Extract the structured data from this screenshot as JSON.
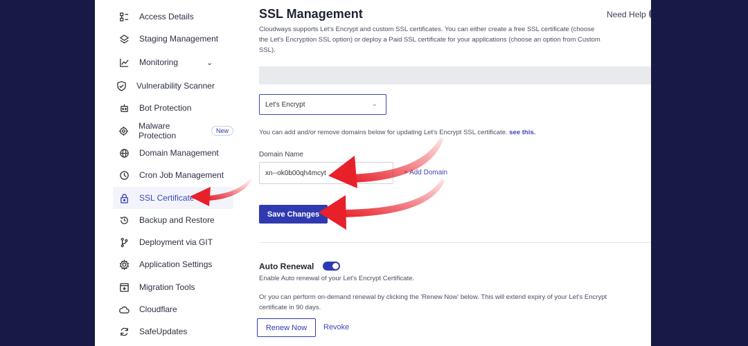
{
  "sidebar": {
    "items": [
      {
        "label": "Access Details",
        "icon": "access-details-icon"
      },
      {
        "label": "Staging Management",
        "icon": "layers-icon"
      },
      {
        "label": "Monitoring",
        "icon": "chart-icon"
      },
      {
        "label": "Vulnerability Scanner",
        "icon": "shield-scan-icon"
      },
      {
        "label": "Bot Protection",
        "icon": "bot-icon"
      },
      {
        "label": "Malware Protection",
        "icon": "malware-icon",
        "badge": "New"
      },
      {
        "label": "Domain Management",
        "icon": "www-icon"
      },
      {
        "label": "Cron Job Management",
        "icon": "clock-icon"
      },
      {
        "label": "SSL Certificate",
        "icon": "lock-icon"
      },
      {
        "label": "Backup and Restore",
        "icon": "restore-icon"
      },
      {
        "label": "Deployment via GIT",
        "icon": "git-branch-icon"
      },
      {
        "label": "Application Settings",
        "icon": "gear-icon"
      },
      {
        "label": "Migration Tools",
        "icon": "migration-icon"
      },
      {
        "label": "Cloudflare",
        "icon": "cloud-icon"
      },
      {
        "label": "SafeUpdates",
        "icon": "refresh-icon"
      }
    ],
    "monitoring_chevron": "⌄"
  },
  "main": {
    "title": "SSL Management",
    "help": "Need Help",
    "description": "Cloudways supports Let's Encrypt and custom SSL certificates. You can either create a free SSL certificate (choose the Let's Encryption SSL option) or deploy a Paid SSL certificate for your applications (choose an option from Custom SSL).",
    "ssl_select": {
      "value": "Let's Encrypt"
    },
    "info_text": "You can add and/or remove domains below for updating Let's Encrypt SSL certificate.",
    "info_link": "see this.",
    "domain_label": "Domain Name",
    "domain_value": "xn--ok0b00qh4mcyt",
    "add_domain": "+ Add Domain",
    "save_button": "Save Changes",
    "auto_renewal": {
      "title": "Auto Renewal",
      "enabled": true,
      "description": "Enable Auto renewal of your Let's Encrypt Certificate.",
      "renew_description": "Or you can perform on-demand renewal by clicking the 'Renew Now' below. This will extend expiry of your Let's Encrypt certificate in 90 days.",
      "renew_button": "Renew Now",
      "revoke": "Revoke"
    }
  },
  "colors": {
    "background": "#161a44",
    "accent": "#2f3ab0",
    "annotation_arrow": "#e8202a"
  }
}
